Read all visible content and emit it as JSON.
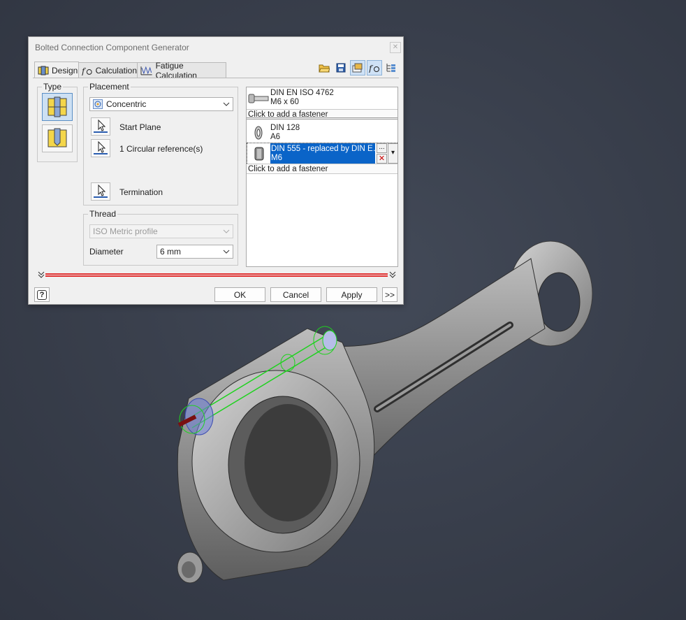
{
  "dialog": {
    "title": "Bolted Connection Component Generator",
    "tabs": [
      {
        "label": "Design",
        "icon": "design-tab-icon",
        "active": true
      },
      {
        "label": "Calculation",
        "icon": "fx-calculation-icon"
      },
      {
        "label": "Fatigue Calculation",
        "icon": "fatigue-graph-icon"
      }
    ],
    "toolbar": [
      "open-folder-icon",
      "save-icon",
      "options-icon",
      "calculate-fx-icon",
      "tree-icon"
    ]
  },
  "type_group": {
    "label": "Type"
  },
  "placement": {
    "label": "Placement",
    "mode": "Concentric",
    "start_plane": "Start Plane",
    "circular_ref": "1 Circular reference(s)",
    "termination": "Termination"
  },
  "thread": {
    "label": "Thread",
    "profile": "ISO Metric profile",
    "diameter_label": "Diameter",
    "diameter_value": "6 mm"
  },
  "fasteners": {
    "items": [
      {
        "name": "DIN EN ISO 4762",
        "size": "M6 x 60"
      },
      {
        "name": "DIN 128",
        "size": "A6"
      },
      {
        "name": "DIN 555 - replaced by DIN E…",
        "size": "M6"
      }
    ],
    "add_label": "Click to add a fastener",
    "ellipsis": "..."
  },
  "buttons": {
    "ok": "OK",
    "cancel": "Cancel",
    "apply": "Apply",
    "more": ">>",
    "help": "?"
  },
  "colors": {
    "accent": "#0a64c8",
    "background": "#3a404d",
    "highlight_green": "#1fd21f"
  }
}
